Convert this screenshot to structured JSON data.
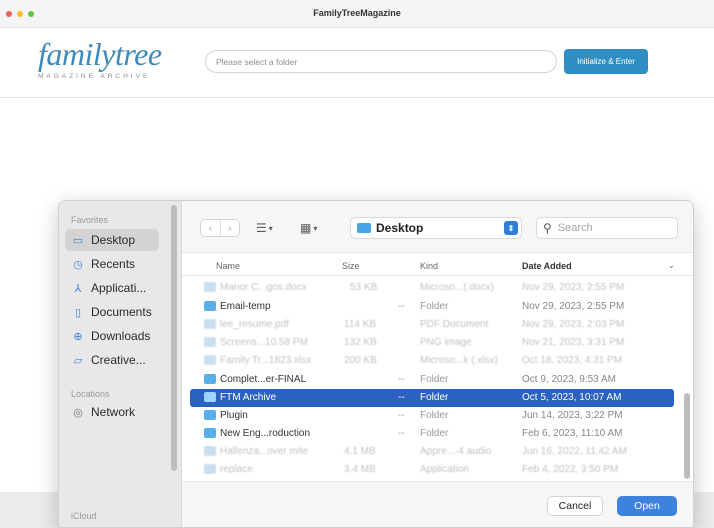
{
  "window": {
    "title": "FamilyTreeMagazine"
  },
  "header": {
    "logo_word": "familytree",
    "logo_sub": "MAGAZINE ARCHIVE",
    "folder_placeholder": "Please select a folder",
    "init_button": "Initialize & Enter"
  },
  "dialog": {
    "sidebar": {
      "favorites_title": "Favorites",
      "favorites": [
        "Desktop",
        "Recents",
        "Applicati...",
        "Documents",
        "Downloads",
        "Creative..."
      ],
      "locations_title": "Locations",
      "locations": [
        "Network"
      ],
      "icloud_title": "iCloud"
    },
    "toolbar": {
      "location": "Desktop",
      "search_placeholder": "Search"
    },
    "columns": {
      "name": "Name",
      "size": "Size",
      "kind": "Kind",
      "date": "Date Added"
    },
    "rows": [
      {
        "name": "Manor C...gos.docx",
        "size": "53 KB",
        "kind": "Microso...(.docx)",
        "date": "Nov 29, 2023, 2:55 PM"
      },
      {
        "name": "Email-temp",
        "size": "--",
        "kind": "Folder",
        "date": "Nov 29, 2023, 2:55 PM"
      },
      {
        "name": "lee_resume.pdf",
        "size": "114 KB",
        "kind": "PDF Document",
        "date": "Nov 29, 2023, 2:03 PM"
      },
      {
        "name": "Screens...10.58 PM",
        "size": "132 KB",
        "kind": "PNG image",
        "date": "Nov 21, 2023, 3:31 PM"
      },
      {
        "name": "Family Tr...1823.xlsx",
        "size": "200 KB",
        "kind": "Microso...k (.xlsx)",
        "date": "Oct 18, 2023, 4:31 PM"
      },
      {
        "name": "Complet...er-FINAL",
        "size": "--",
        "kind": "Folder",
        "date": "Oct 9, 2023, 9:53 AM"
      },
      {
        "name": "FTM Archive",
        "size": "--",
        "kind": "Folder",
        "date": "Oct 5, 2023, 10:07 AM"
      },
      {
        "name": "Plugin",
        "size": "--",
        "kind": "Folder",
        "date": "Jun 14, 2023, 3:22 PM"
      },
      {
        "name": "New Eng...roduction",
        "size": "--",
        "kind": "Folder",
        "date": "Feb 6, 2023, 11:10 AM"
      },
      {
        "name": "Hallenza...over mite",
        "size": "4.1 MB",
        "kind": "Appre...-4 audio",
        "date": "Jun 16, 2022, 11:42 AM"
      },
      {
        "name": "replace",
        "size": "3.4 MB",
        "kind": "Application",
        "date": "Feb 4, 2022, 3:50 PM"
      }
    ],
    "cancel": "Cancel",
    "open": "Open"
  }
}
